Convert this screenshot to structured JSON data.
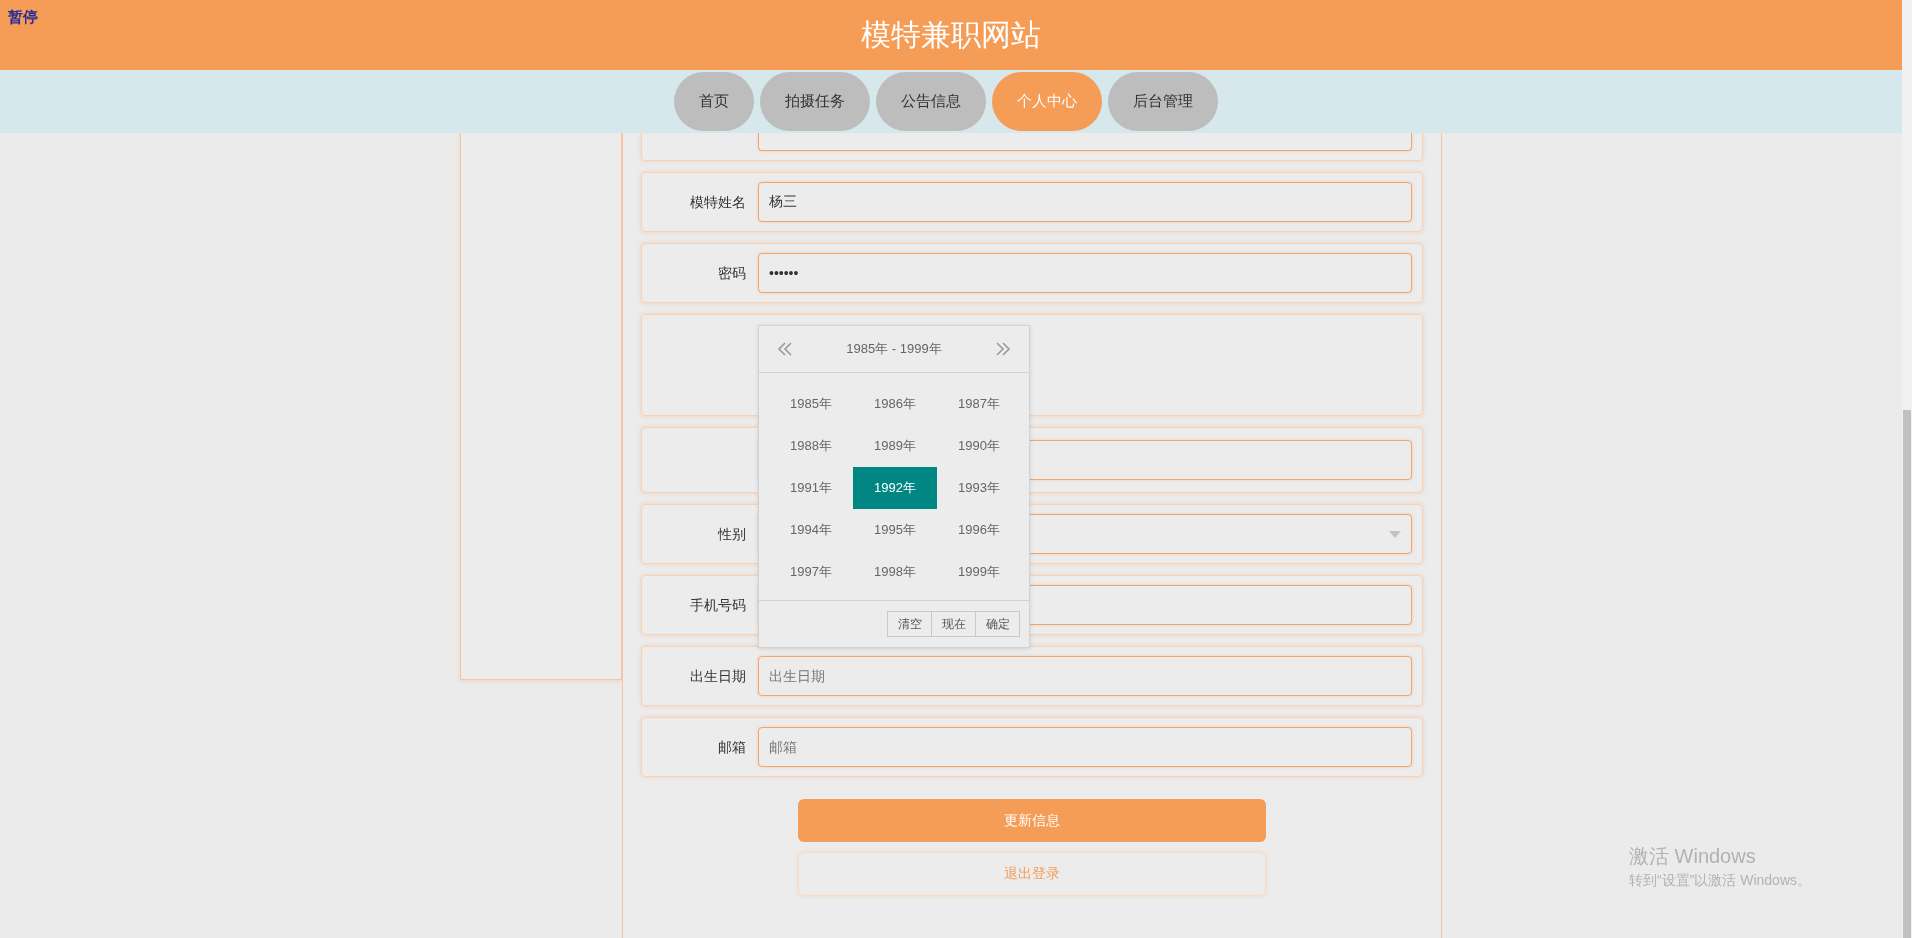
{
  "pause_label": "暂停",
  "site_title": "模特兼职网站",
  "nav": [
    {
      "label": "首页",
      "selected": false
    },
    {
      "label": "拍摄任务",
      "selected": false
    },
    {
      "label": "公告信息",
      "selected": false
    },
    {
      "label": "个人中心",
      "selected": true
    },
    {
      "label": "后台管理",
      "selected": false
    }
  ],
  "form": {
    "fields": [
      {
        "kind": "covered"
      },
      {
        "kind": "input",
        "label": "模特姓名",
        "value": "杨三"
      },
      {
        "kind": "input",
        "label": "密码",
        "value": "••••••"
      },
      {
        "kind": "covered_tall"
      },
      {
        "kind": "covered"
      },
      {
        "kind": "select",
        "label": "性别"
      },
      {
        "kind": "input",
        "label": "手机号码"
      },
      {
        "kind": "input",
        "label": "出生日期",
        "placeholder": "出生日期"
      },
      {
        "kind": "input",
        "label": "邮箱",
        "placeholder": "邮箱"
      }
    ],
    "update_button": "更新信息",
    "logout_button": "退出登录"
  },
  "date_picker": {
    "range_label": "1985年 - 1999年",
    "years": [
      {
        "label": "1985年",
        "selected": false
      },
      {
        "label": "1986年",
        "selected": false
      },
      {
        "label": "1987年",
        "selected": false
      },
      {
        "label": "1988年",
        "selected": false
      },
      {
        "label": "1989年",
        "selected": false
      },
      {
        "label": "1990年",
        "selected": false
      },
      {
        "label": "1991年",
        "selected": false
      },
      {
        "label": "1992年",
        "selected": true
      },
      {
        "label": "1993年",
        "selected": false
      },
      {
        "label": "1994年",
        "selected": false
      },
      {
        "label": "1995年",
        "selected": false
      },
      {
        "label": "1996年",
        "selected": false
      },
      {
        "label": "1997年",
        "selected": false
      },
      {
        "label": "1998年",
        "selected": false
      },
      {
        "label": "1999年",
        "selected": false
      }
    ],
    "buttons": [
      "清空",
      "现在",
      "确定"
    ]
  },
  "activation_notice": {
    "title": "激活 Windows",
    "subtitle": "转到“设置”以激活 Windows。"
  }
}
